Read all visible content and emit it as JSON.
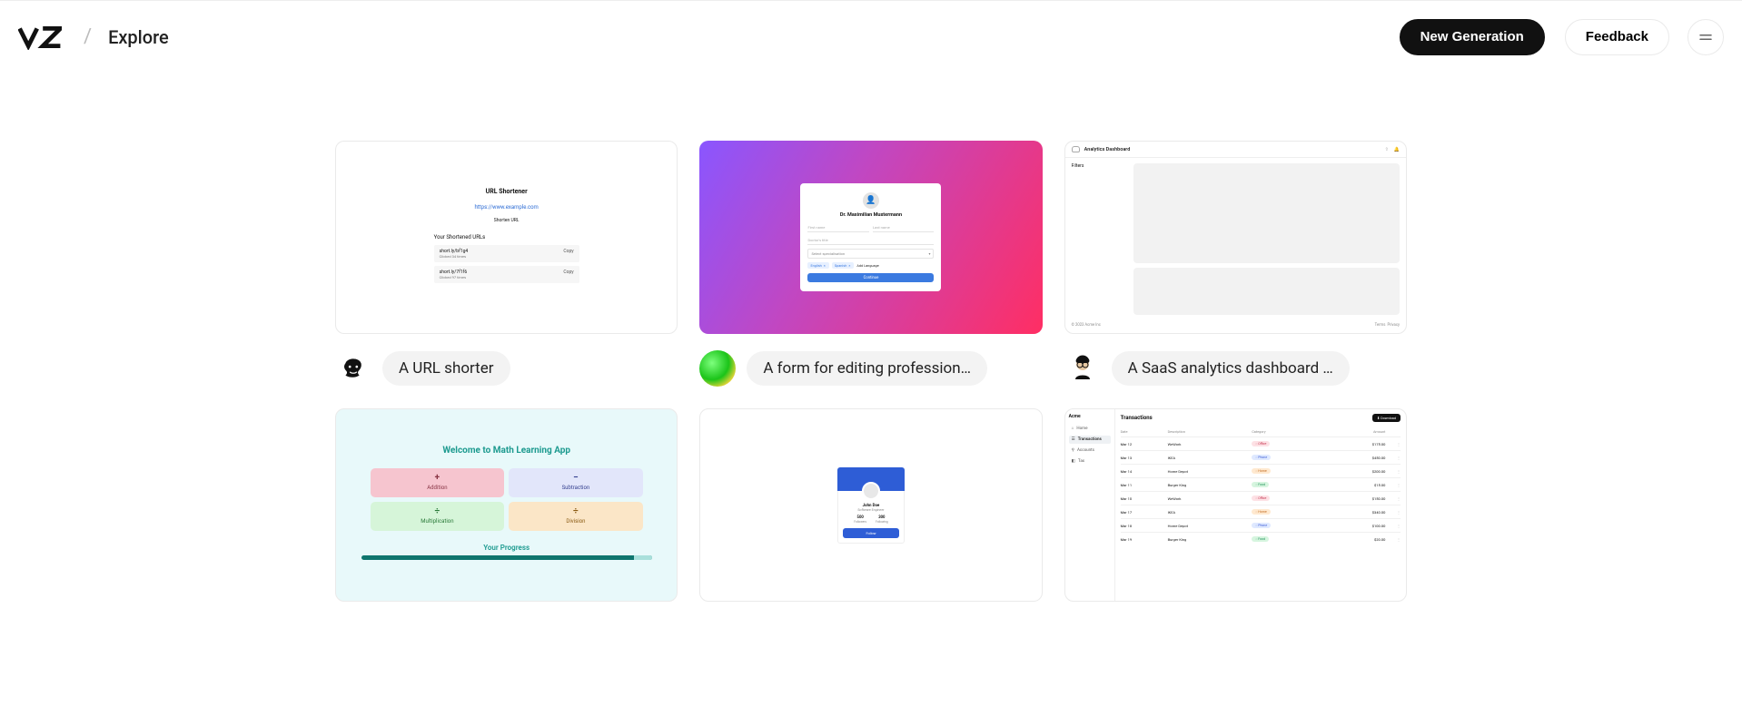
{
  "header": {
    "page_title": "Explore",
    "new_generation": "New Generation",
    "feedback": "Feedback"
  },
  "cards": [
    {
      "caption": "A URL shorter"
    },
    {
      "caption": "A form for editing profession…"
    },
    {
      "caption": "A SaaS analytics dashboard …"
    }
  ],
  "thumb1": {
    "title": "URL Shortener",
    "example_url": "https://www.example.com",
    "shorten_btn": "Shorten URL",
    "list_title": "Your Shortened URLs",
    "rows": [
      {
        "short": "short.ly/bf1g4",
        "meta": "Clicked 34 times",
        "action": "Copy"
      },
      {
        "short": "short.ly/7f1f6",
        "meta": "Clicked 97 times",
        "action": "Copy"
      }
    ]
  },
  "thumb2": {
    "name": "Dr. Maximilian Mustermann",
    "first_name_ph": "First name",
    "last_name_ph": "Last name",
    "title_ph": "Doctor's title",
    "select_ph": "Select specialisation",
    "tags": [
      "English",
      "Spanish"
    ],
    "add_lang": "Add Language",
    "continue": "Continue"
  },
  "thumb3": {
    "title": "Analytics Dashboard",
    "filters": "Filters",
    "footer_left": "© 2023 Acme Inc",
    "footer_terms": "Terms",
    "footer_privacy": "Privacy"
  },
  "thumb4": {
    "title": "Welcome to Math Learning App",
    "tiles": {
      "add": "Addition",
      "sub": "Subtraction",
      "mul": "Multiplication",
      "div": "Division"
    },
    "progress": "Your Progress"
  },
  "thumb5": {
    "name": "John Doe",
    "role": "Software Engineer",
    "followers_n": "500",
    "followers_l": "Followers",
    "following_n": "300",
    "following_l": "Following",
    "follow": "Follow"
  },
  "thumb6": {
    "brand": "Acme",
    "nav": {
      "home": "Home",
      "tx": "Transactions",
      "acc": "Accounts",
      "tax": "Tax"
    },
    "title": "Transactions",
    "download": "⬇ Download",
    "headers": {
      "date": "Date",
      "desc": "Description",
      "cat": "Category",
      "amt": "Amount"
    },
    "rows": [
      {
        "date": "Mar 12",
        "desc": "WeWork",
        "cat": "Office",
        "cls": "p-office",
        "amt": "$175.00"
      },
      {
        "date": "Mar 13",
        "desc": "IKEA",
        "cat": "Phone",
        "cls": "p-phone",
        "amt": "$450.00"
      },
      {
        "date": "Mar 14",
        "desc": "Home Depot",
        "cat": "Home",
        "cls": "p-home",
        "amt": "$200.00"
      },
      {
        "date": "Mar 11",
        "desc": "Burger King",
        "cat": "Food",
        "cls": "p-food",
        "amt": "$15.00"
      },
      {
        "date": "Mar 10",
        "desc": "WeWork",
        "cat": "Office",
        "cls": "p-office2",
        "amt": "$150.00"
      },
      {
        "date": "Mar 17",
        "desc": "IKEA",
        "cat": "Home",
        "cls": "p-home",
        "amt": "$340.00"
      },
      {
        "date": "Mar 18",
        "desc": "Home Depot",
        "cat": "Phone",
        "cls": "p-phone",
        "amt": "$100.00"
      },
      {
        "date": "Mar 19",
        "desc": "Burger King",
        "cat": "Food",
        "cls": "p-food",
        "amt": "$20.00"
      }
    ]
  }
}
